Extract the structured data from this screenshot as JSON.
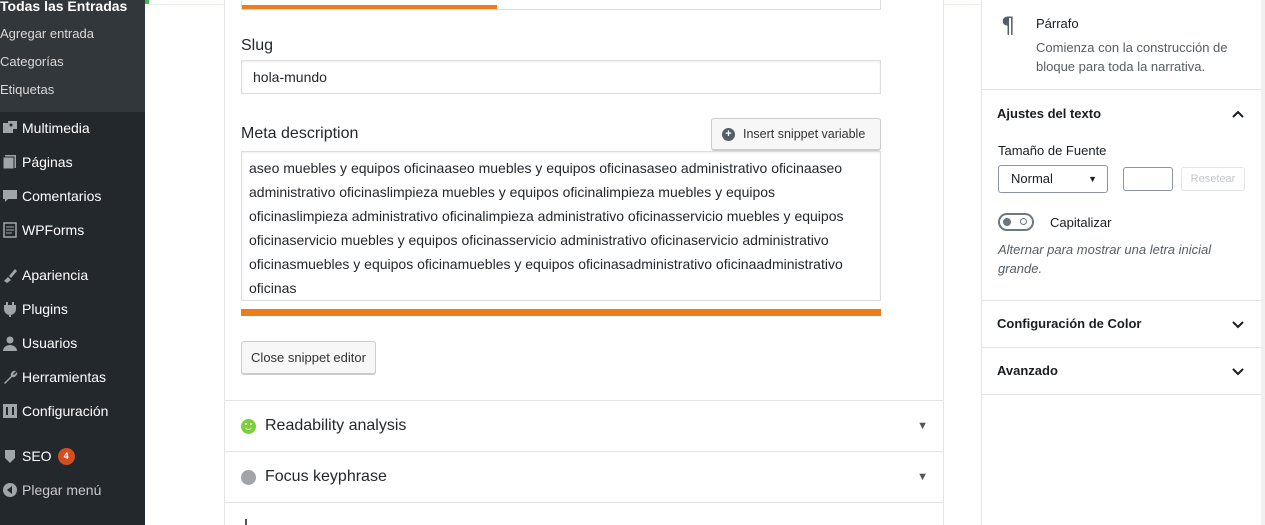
{
  "sidebar": {
    "submenu": [
      {
        "label": "Todas las Entradas",
        "current": true
      },
      {
        "label": "Agregar entrada"
      },
      {
        "label": "Categorías"
      },
      {
        "label": "Etiquetas"
      }
    ],
    "menu": [
      {
        "label": "Multimedia",
        "icon": "media-icon"
      },
      {
        "label": "Páginas",
        "icon": "pages-icon"
      },
      {
        "label": "Comentarios",
        "icon": "comments-icon"
      },
      {
        "label": "WPForms",
        "icon": "wpforms-icon"
      },
      {
        "label": "Apariencia",
        "icon": "appearance-icon"
      },
      {
        "label": "Plugins",
        "icon": "plugins-icon"
      },
      {
        "label": "Usuarios",
        "icon": "users-icon"
      },
      {
        "label": "Herramientas",
        "icon": "tools-icon"
      },
      {
        "label": "Configuración",
        "icon": "settings-icon"
      },
      {
        "label": "SEO",
        "icon": "seo-icon",
        "badge": "4"
      },
      {
        "label": "Plegar menú",
        "icon": "collapse-icon"
      }
    ]
  },
  "snippet": {
    "preview_score": 0.4,
    "slug_label": "Slug",
    "slug_value": "hola-mundo",
    "meta_label": "Meta description",
    "insert_button": "Insert snippet variable",
    "meta_value": "aseo muebles y equipos oficinaaseo muebles y equipos oficinasaseo administrativo oficinaaseo administrativo oficinaslimpieza muebles y equipos oficinalimpieza muebles y equipos oficinaslimpieza administrativo oficinalimpieza administrativo oficinasservicio muebles y equipos oficinaservicio muebles y equipos oficinasservicio administrativo oficinaservicio administrativo oficinasmuebles y equipos oficinamuebles y equipos oficinasadministrativo oficinaadministrativo oficinas",
    "meta_length_score": 1.0,
    "close_button": "Close snippet editor",
    "progress_color": "#ee7c1b"
  },
  "analysis": {
    "readability_label": "Readability analysis",
    "readability_status": "good",
    "readability_color": "#7ad03a",
    "focus_label": "Focus keyphrase",
    "focus_status": "none",
    "focus_color": "#a0a5aa"
  },
  "block_panel": {
    "block_name": "Párrafo",
    "block_description": "Comienza con la construcción de bloque para toda la narrativa.",
    "text_settings_title": "Ajustes del texto",
    "font_size_label": "Tamaño de Fuente",
    "font_size_value": "Normal",
    "font_size_custom": "",
    "reset_button": "Resetear",
    "dropcap_label": "Capitalizar",
    "dropcap_on": false,
    "dropcap_help": "Alternar para mostrar una letra inicial grande.",
    "color_settings_title": "Configuración de Color",
    "advanced_title": "Avanzado"
  }
}
